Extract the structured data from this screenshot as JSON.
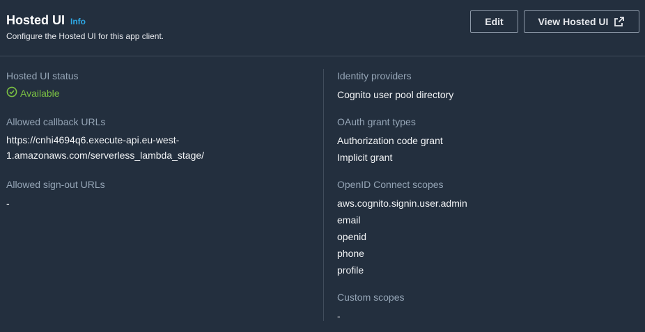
{
  "header": {
    "title": "Hosted UI",
    "info_label": "Info",
    "subtitle": "Configure the Hosted UI for this app client.",
    "edit_label": "Edit",
    "view_label": "View Hosted UI"
  },
  "left": {
    "status_label": "Hosted UI status",
    "status_value": "Available",
    "status_color": "#7bc043",
    "callback_label": "Allowed callback URLs",
    "callback_line1": "https://cnhi4694q6.execute-api.eu-west-",
    "callback_line2": "1.amazonaws.com/serverless_lambda_stage/",
    "signout_label": "Allowed sign-out URLs",
    "signout_value": "-"
  },
  "right": {
    "idp_label": "Identity providers",
    "idp_value": "Cognito user pool directory",
    "oauth_label": "OAuth grant types",
    "oauth_values": [
      "Authorization code grant",
      "Implicit grant"
    ],
    "oidc_label": "OpenID Connect scopes",
    "oidc_values": [
      "aws.cognito.signin.user.admin",
      "email",
      "openid",
      "phone",
      "profile"
    ],
    "custom_label": "Custom scopes",
    "custom_value": "-"
  },
  "icons": {
    "status": "check-circle-icon",
    "external": "external-link-icon"
  }
}
